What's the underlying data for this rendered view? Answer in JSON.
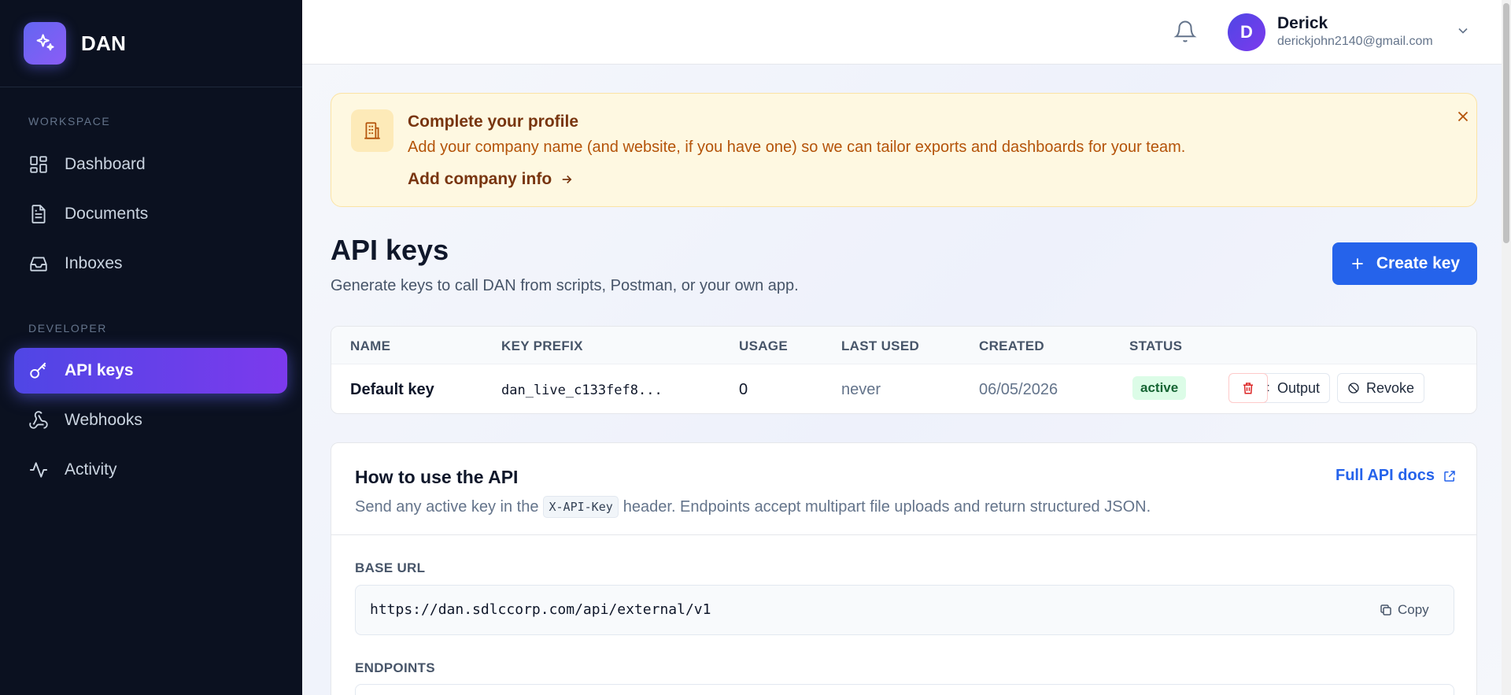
{
  "brand": {
    "name": "DAN"
  },
  "sidebar": {
    "workspace_label": "WORKSPACE",
    "developer_label": "DEVELOPER",
    "items": [
      {
        "label": "Dashboard",
        "icon": "dashboard-icon"
      },
      {
        "label": "Documents",
        "icon": "document-icon"
      },
      {
        "label": "Inboxes",
        "icon": "inbox-icon"
      },
      {
        "label": "API keys",
        "icon": "key-icon",
        "active": true
      },
      {
        "label": "Webhooks",
        "icon": "webhook-icon"
      },
      {
        "label": "Activity",
        "icon": "activity-icon"
      }
    ]
  },
  "user": {
    "initial": "D",
    "name": "Derick",
    "email": "derickjohn2140@gmail.com"
  },
  "banner": {
    "title": "Complete your profile",
    "text": "Add your company name (and website, if you have one) so we can tailor exports and dashboards for your team.",
    "link": "Add company info"
  },
  "page": {
    "title": "API keys",
    "subtitle": "Generate keys to call DAN from scripts, Postman, or your own app.",
    "create_button": "Create key"
  },
  "table": {
    "headers": [
      "NAME",
      "KEY PREFIX",
      "USAGE",
      "LAST USED",
      "CREATED",
      "STATUS"
    ],
    "rows": [
      {
        "name": "Default key",
        "prefix": "dan_live_c133fef8...",
        "usage": "0",
        "last_used": "never",
        "created": "06/05/2026",
        "status": "active",
        "output_label": "Output",
        "revoke_label": "Revoke"
      }
    ]
  },
  "api": {
    "title": "How to use the API",
    "docs_link": "Full API docs",
    "desc_before": "Send any active key in the",
    "header_name": "X-API-Key",
    "desc_after": "header. Endpoints accept multipart file uploads and return structured JSON.",
    "base_url_label": "BASE URL",
    "base_url": "https://dan.sdlccorp.com/api/external/v1",
    "copy_label": "Copy",
    "endpoints_label": "ENDPOINTS"
  },
  "colors": {
    "accent": "#2563eb",
    "brand_gradient": [
      "#6366f1",
      "#8b5cf6"
    ],
    "active_status": "#dcfce7"
  }
}
